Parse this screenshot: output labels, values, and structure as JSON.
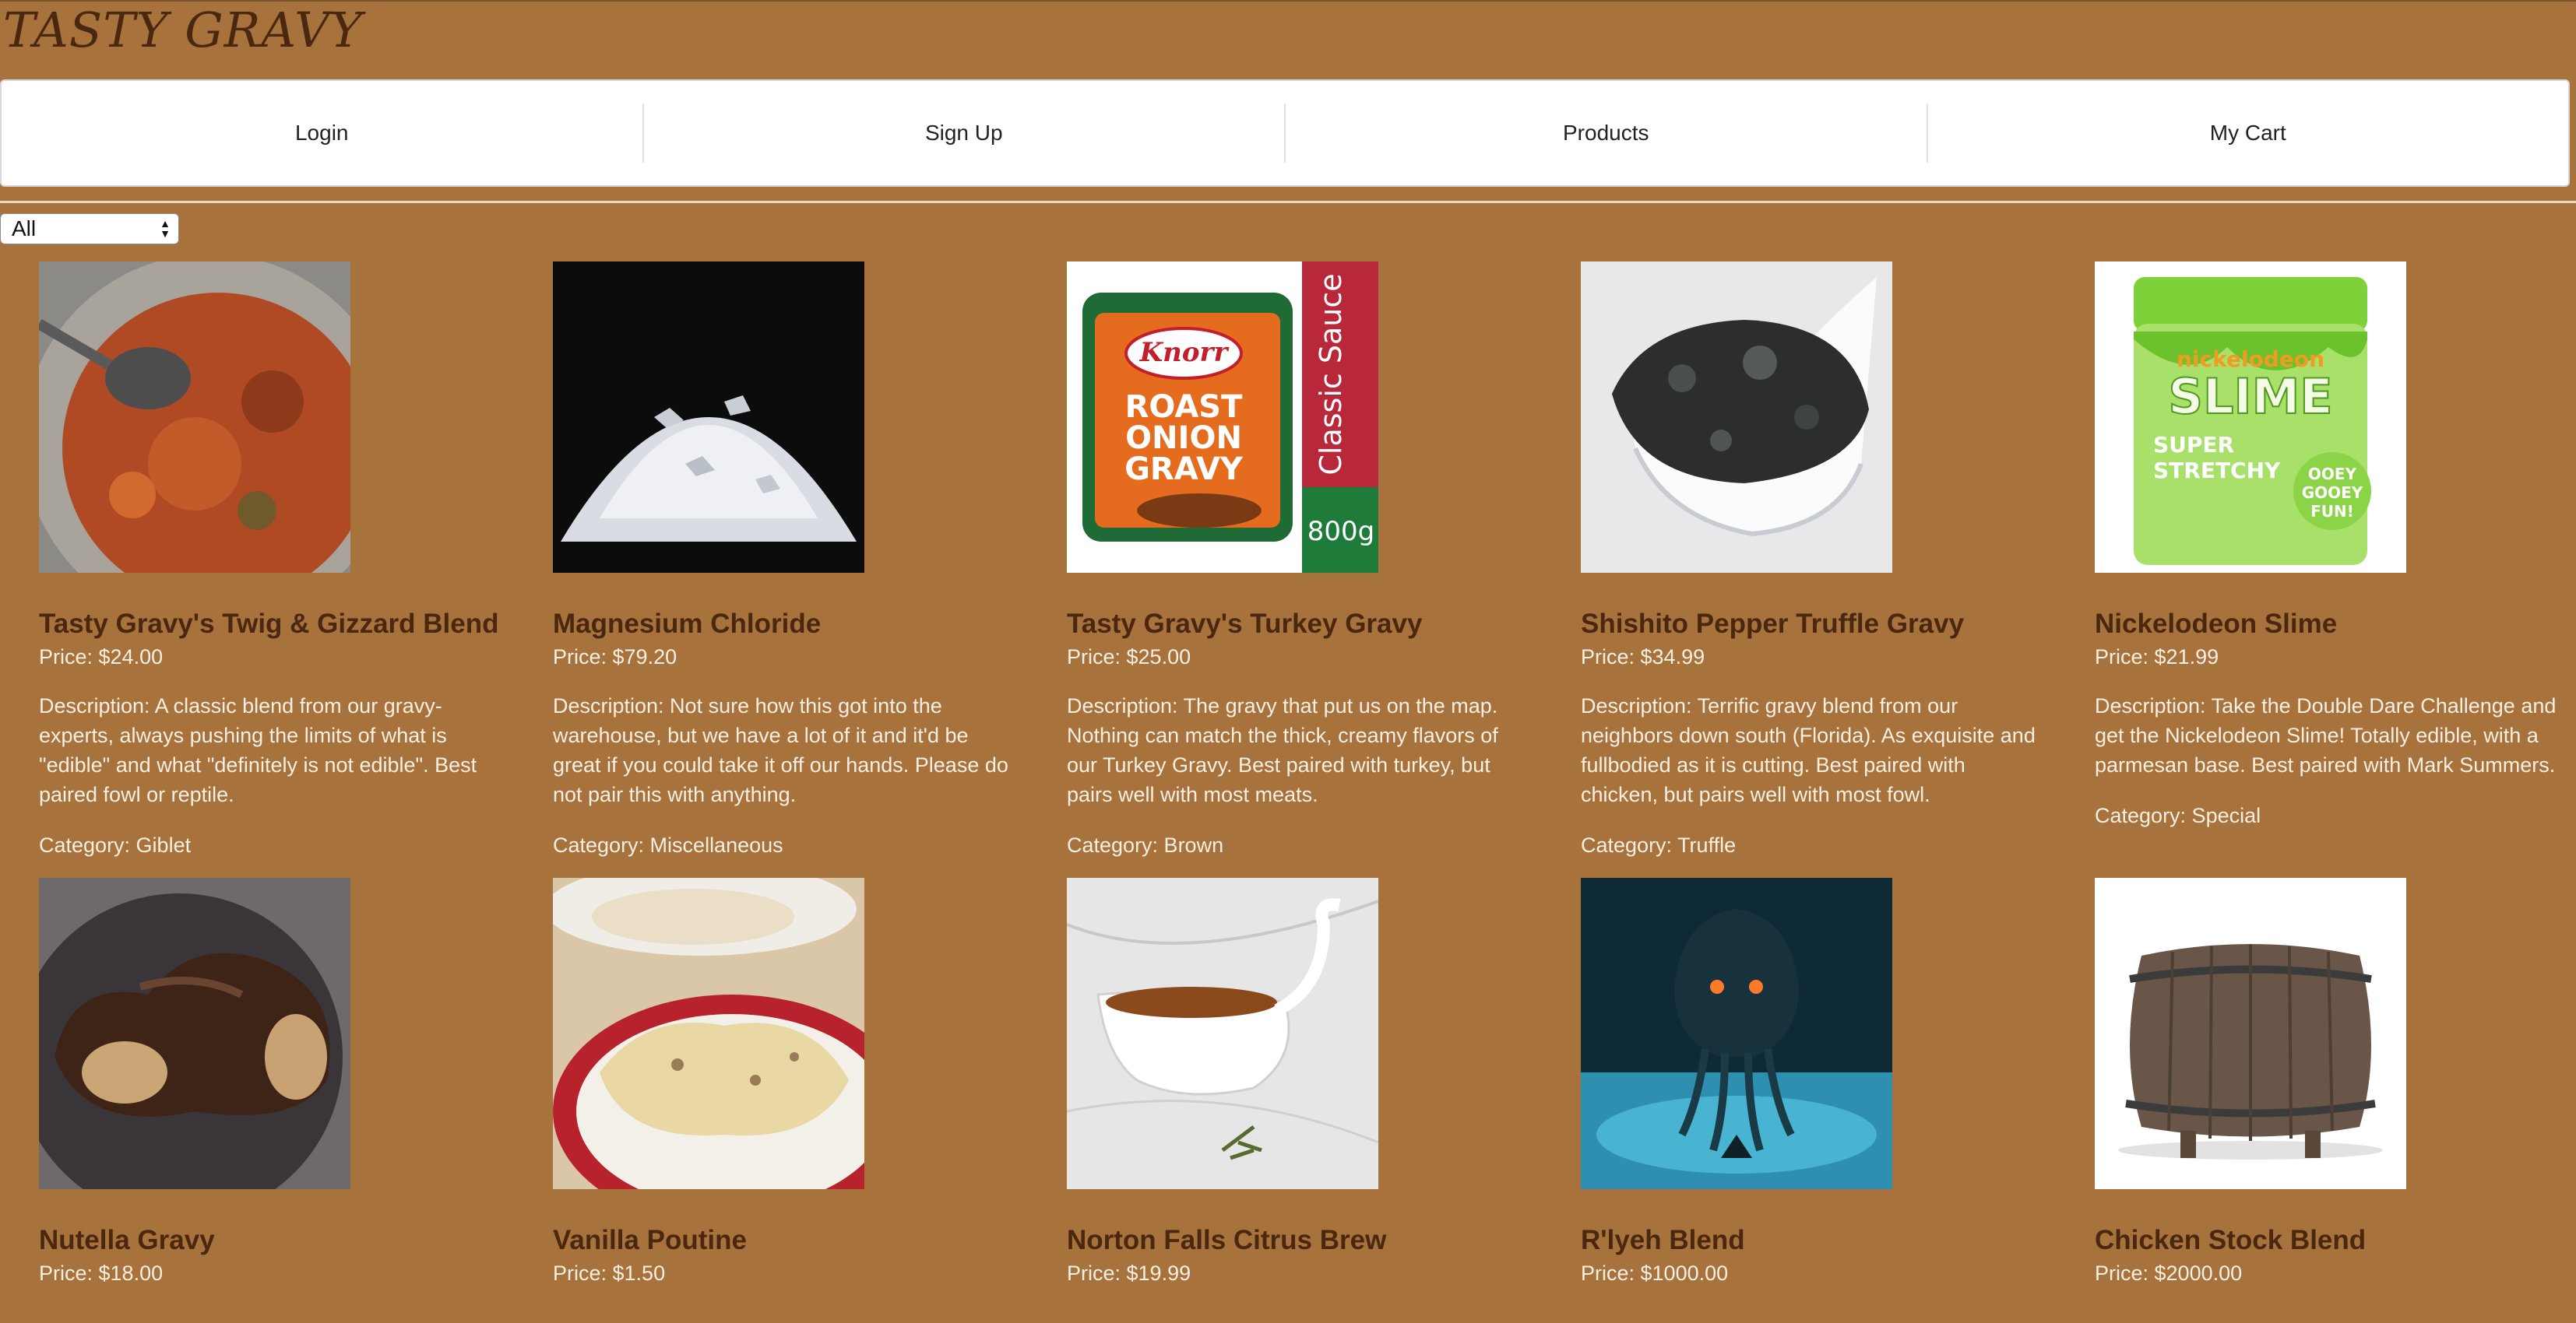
{
  "brand": "TASTY GRAVY",
  "nav": [
    "Login",
    "Sign Up",
    "Products",
    "My Cart"
  ],
  "filter": {
    "selected": "All"
  },
  "products": [
    {
      "name": "Tasty Gravy's Twig & Gizzard Blend",
      "price": "Price: $24.00",
      "description": "Description: A classic blend from our gravy-experts, always pushing the limits of what is \"edible\" and what \"definitely is not edible\". Best paired fowl or reptile.",
      "category": "Category: Giblet"
    },
    {
      "name": "Magnesium Chloride",
      "price": "Price: $79.20",
      "description": "Description: Not sure how this got into the warehouse, but we have a lot of it and it'd be great if you could take it off our hands. Please do not pair this with anything.",
      "category": "Category: Miscellaneous"
    },
    {
      "name": "Tasty Gravy's Turkey Gravy",
      "price": "Price: $25.00",
      "description": "Description: The gravy that put us on the map. Nothing can match the thick, creamy flavors of our Turkey Gravy. Best paired with turkey, but pairs well with most meats.",
      "category": "Category: Brown",
      "image_text": {
        "brand": "Knorr",
        "line1": "ROAST",
        "line2": "ONION",
        "line3": "GRAVY",
        "side": "Classic Sauce",
        "weight": "800g"
      }
    },
    {
      "name": "Shishito Pepper Truffle Gravy",
      "price": "Price: $34.99",
      "description": "Description: Terrific gravy blend from our neighbors down south (Florida). As exquisite and fullbodied as it is cutting. Best paired with chicken, but pairs well with most fowl.",
      "category": "Category: Truffle"
    },
    {
      "name": "Nickelodeon Slime",
      "price": "Price: $21.99",
      "description": "Description: Take the Double Dare Challenge and get the Nickelodeon Slime! Totally edible, with a parmesan base. Best paired with Mark Summers.",
      "category": "Category: Special",
      "image_text": {
        "brand": "nickelodeon",
        "title": "SLIME",
        "tag1": "SUPER",
        "tag2": "STRETCHY",
        "badge1": "OOEY",
        "badge2": "GOOEY",
        "badge3": "FUN!"
      }
    },
    {
      "name": "Nutella Gravy",
      "price": "Price: $18.00"
    },
    {
      "name": "Vanilla Poutine",
      "price": "Price: $1.50"
    },
    {
      "name": "Norton Falls Citrus Brew",
      "price": "Price: $19.99"
    },
    {
      "name": "R'lyeh Blend",
      "price": "Price: $1000.00"
    },
    {
      "name": "Chicken Stock Blend",
      "price": "Price: $2000.00"
    }
  ]
}
